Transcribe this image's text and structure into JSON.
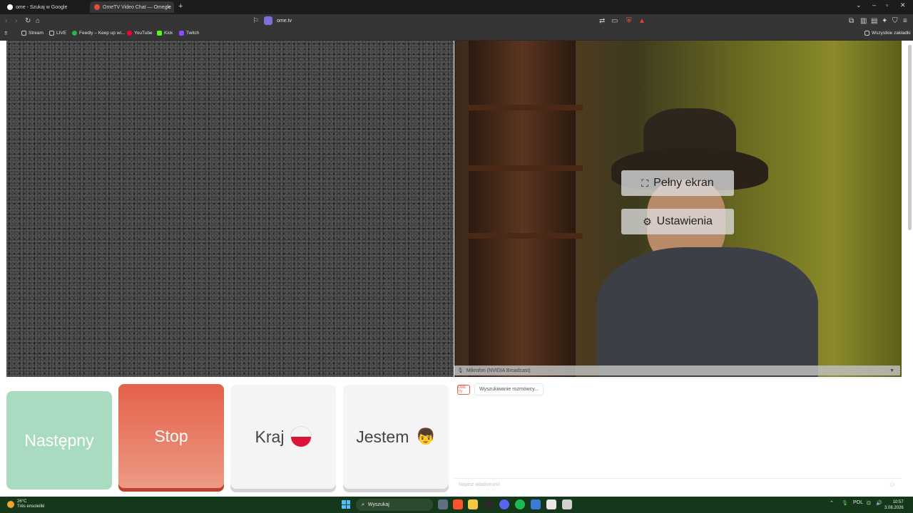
{
  "tabs": [
    {
      "label": "ome - Szukaj w Google",
      "active": false
    },
    {
      "label": "OmeTV Video Chat — Omegle",
      "active": true
    }
  ],
  "address_bar": {
    "url": "ome.tv"
  },
  "bookmarks": [
    {
      "label": "Stream"
    },
    {
      "label": "LIVE"
    },
    {
      "label": "Feedly – Keep up wi..."
    },
    {
      "label": "YouTube"
    },
    {
      "label": "Kick"
    },
    {
      "label": "Twitch"
    }
  ],
  "bookmarks_all": "Wszystkie zakładki",
  "video_controls": {
    "fullscreen_label": "Pełny ekran",
    "settings_label": "Ustawienia"
  },
  "mic_select": {
    "value": "Mikrofon (NVIDIA Broadcast)"
  },
  "buttons": {
    "next": "Następny",
    "stop": "Stop",
    "country": "Kraj",
    "me": "Jestem"
  },
  "chat": {
    "status": "Wyszukiwanie rozmówcy...",
    "placeholder": "Napisz wiadomość",
    "logo": "OME TV"
  },
  "taskbar": {
    "temperature": "26°C",
    "weather": "Trés ensoleillé",
    "search": "Wyszukaj",
    "language": "POL",
    "time": "10:57",
    "date": "3.08.2026"
  },
  "colors": {
    "stop": "#e4614a",
    "next": "#a8dbc0",
    "accent": "#e05a47"
  }
}
